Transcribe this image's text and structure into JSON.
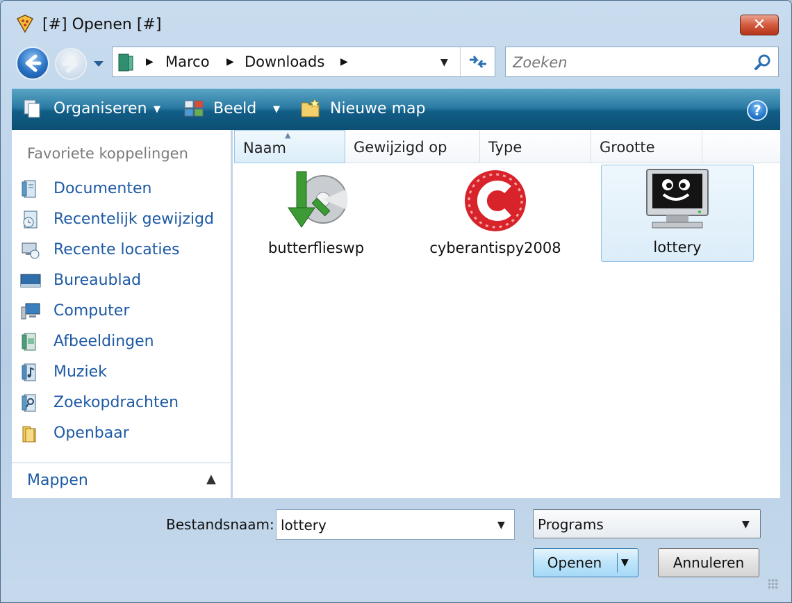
{
  "window": {
    "title": "[#] Openen [#]",
    "close_label": "✕"
  },
  "address_bar": {
    "crumbs": [
      "Marco",
      "Downloads"
    ]
  },
  "search": {
    "placeholder": "Zoeken"
  },
  "toolbar": {
    "organize": "Organiseren",
    "view": "Beeld",
    "new_folder": "Nieuwe map",
    "help": "?"
  },
  "sidebar": {
    "favorites_header": "Favoriete koppelingen",
    "items": [
      {
        "label": "Documenten",
        "icon": "documents-icon"
      },
      {
        "label": "Recentelijk gewijzigd",
        "icon": "recently-changed-icon"
      },
      {
        "label": "Recente locaties",
        "icon": "recent-places-icon"
      },
      {
        "label": "Bureaublad",
        "icon": "desktop-icon"
      },
      {
        "label": "Computer",
        "icon": "computer-icon"
      },
      {
        "label": "Afbeeldingen",
        "icon": "pictures-icon"
      },
      {
        "label": "Muziek",
        "icon": "music-icon"
      },
      {
        "label": "Zoekopdrachten",
        "icon": "searches-icon"
      },
      {
        "label": "Openbaar",
        "icon": "public-folder-icon"
      }
    ],
    "folders_label": "Mappen"
  },
  "columns": [
    "Naam",
    "Gewijzigd op",
    "Type",
    "Grootte"
  ],
  "files": [
    {
      "name": "butterflieswp",
      "icon": "installer-disc-icon",
      "selected": false
    },
    {
      "name": "cyberantispy2008",
      "icon": "cyberantispy-icon",
      "selected": false
    },
    {
      "name": "lottery",
      "icon": "monitor-smiley-icon",
      "selected": true
    }
  ],
  "footer": {
    "filename_label": "Bestandsnaam:",
    "filename_value": "lottery",
    "file_type": "Programs",
    "open_button": "Openen",
    "cancel_button": "Annuleren"
  },
  "colors": {
    "accent": "#1d5aa5",
    "command_bar": "#115d86",
    "selection": "#dcedf9"
  }
}
